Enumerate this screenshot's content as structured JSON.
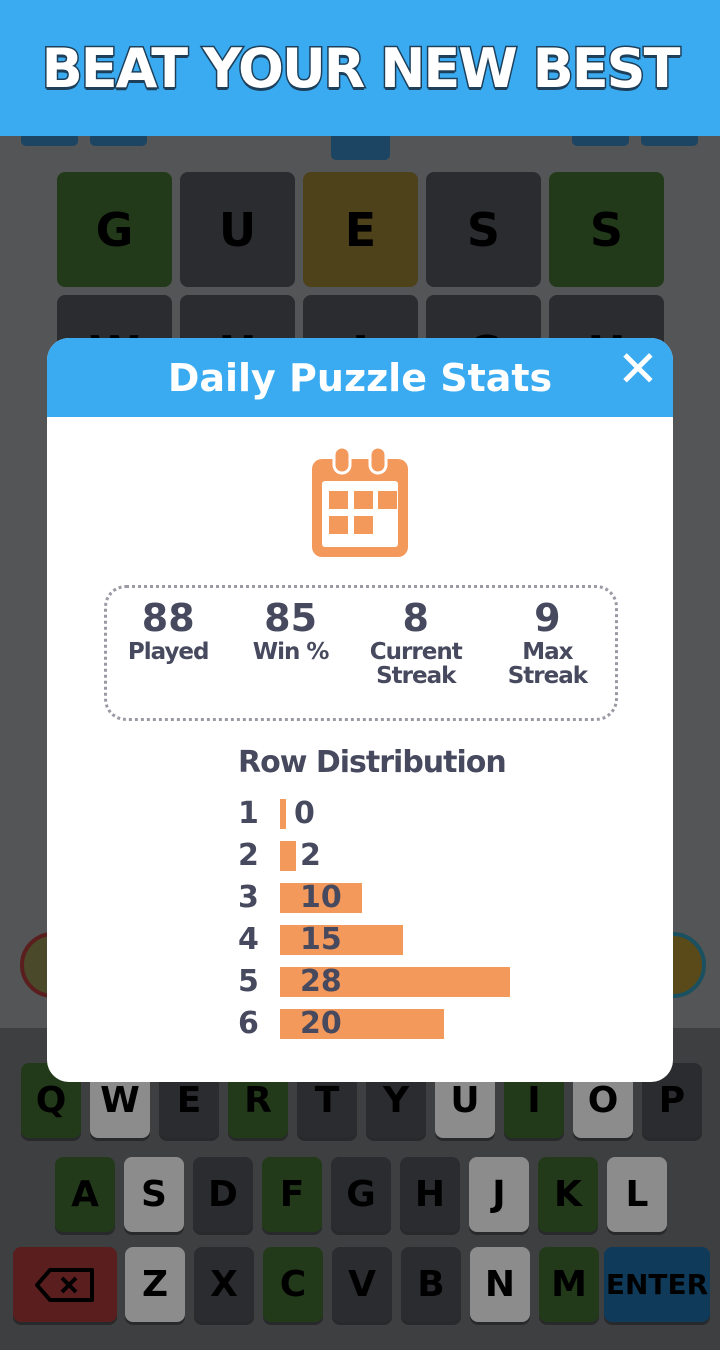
{
  "banner": {
    "title": "BEAT YOUR NEW BEST",
    "color": "#3aabf0"
  },
  "board": {
    "rows": [
      [
        {
          "letter": "G",
          "state": "correct"
        },
        {
          "letter": "U",
          "state": "absent"
        },
        {
          "letter": "E",
          "state": "present"
        },
        {
          "letter": "S",
          "state": "absent"
        },
        {
          "letter": "S",
          "state": "correct"
        }
      ],
      [
        {
          "letter": "W",
          "state": "absent"
        },
        {
          "letter": "H",
          "state": "absent"
        },
        {
          "letter": "I",
          "state": "absent"
        },
        {
          "letter": "C",
          "state": "absent"
        },
        {
          "letter": "H",
          "state": "absent"
        }
      ]
    ]
  },
  "modal": {
    "title": "Daily Puzzle Stats",
    "close_icon": "close-icon",
    "icon": "calendar-icon",
    "stats": [
      {
        "value": "88",
        "label": "Played"
      },
      {
        "value": "85",
        "label": "Win %"
      },
      {
        "value": "8",
        "label": "Current Streak"
      },
      {
        "value": "9",
        "label": "Max Streak"
      }
    ],
    "distribution_title": "Row Distribution",
    "accent": "#f4995c"
  },
  "chart_data": {
    "type": "bar",
    "orientation": "horizontal",
    "title": "Row Distribution",
    "categories": [
      "1",
      "2",
      "3",
      "4",
      "5",
      "6"
    ],
    "values": [
      0,
      2,
      10,
      15,
      28,
      20
    ]
  },
  "keyboard": {
    "row1": [
      {
        "k": "Q",
        "s": "g"
      },
      {
        "k": "W",
        "s": "l"
      },
      {
        "k": "E",
        "s": "d"
      },
      {
        "k": "R",
        "s": "g"
      },
      {
        "k": "T",
        "s": "d"
      },
      {
        "k": "Y",
        "s": "d"
      },
      {
        "k": "U",
        "s": "l"
      },
      {
        "k": "I",
        "s": "g"
      },
      {
        "k": "O",
        "s": "l"
      },
      {
        "k": "P",
        "s": "d"
      }
    ],
    "row2": [
      {
        "k": "A",
        "s": "g"
      },
      {
        "k": "S",
        "s": "l"
      },
      {
        "k": "D",
        "s": "d"
      },
      {
        "k": "F",
        "s": "g"
      },
      {
        "k": "G",
        "s": "d"
      },
      {
        "k": "H",
        "s": "d"
      },
      {
        "k": "J",
        "s": "l"
      },
      {
        "k": "K",
        "s": "g"
      },
      {
        "k": "L",
        "s": "l"
      }
    ],
    "row3": [
      {
        "k": "Z",
        "s": "l"
      },
      {
        "k": "X",
        "s": "d"
      },
      {
        "k": "C",
        "s": "g"
      },
      {
        "k": "V",
        "s": "d"
      },
      {
        "k": "B",
        "s": "d"
      },
      {
        "k": "N",
        "s": "l"
      },
      {
        "k": "M",
        "s": "g"
      }
    ],
    "backspace_icon": "backspace-icon",
    "enter_label": "ENTER"
  }
}
